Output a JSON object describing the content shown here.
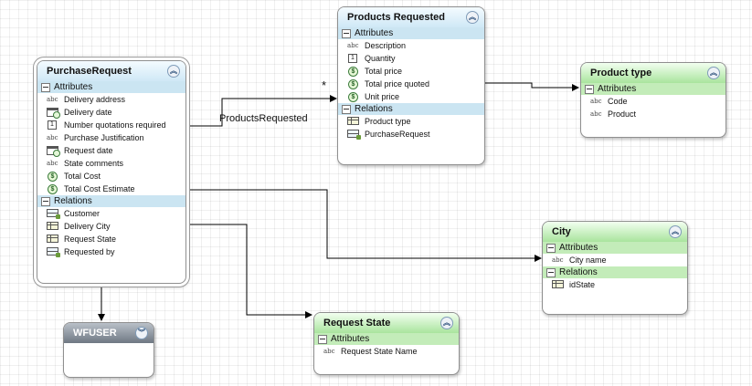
{
  "connector_labels": {
    "relation": "ProductsRequested",
    "multiplicity": "*"
  },
  "entities": {
    "purchase_request": {
      "title": "PurchaseRequest",
      "attributes_label": "Attributes",
      "attributes": [
        "Delivery address",
        "Delivery date",
        "Number quotations required",
        "Purchase Justification",
        "Request date",
        "State comments",
        "Total Cost",
        "Total Cost Estimate"
      ],
      "relations_label": "Relations",
      "relations": [
        "Customer",
        "Delivery City",
        "Request State",
        "Requested by"
      ]
    },
    "products_requested": {
      "title": "Products Requested",
      "attributes_label": "Attributes",
      "attributes": [
        "Description",
        "Quantity",
        "Total price",
        "Total price quoted",
        "Unit price"
      ],
      "relations_label": "Relations",
      "relations": [
        "Product type",
        "PurchaseRequest"
      ]
    },
    "product_type": {
      "title": "Product type",
      "attributes_label": "Attributes",
      "attributes": [
        "Code",
        "Product"
      ]
    },
    "city": {
      "title": "City",
      "attributes_label": "Attributes",
      "attributes": [
        "City name"
      ],
      "relations_label": "Relations",
      "relations": [
        "idState"
      ]
    },
    "request_state": {
      "title": "Request State",
      "attributes_label": "Attributes",
      "attributes": [
        "Request State Name"
      ]
    },
    "wfuser": {
      "title": "WFUSER"
    }
  },
  "icons": {
    "text": "abc-icon",
    "date": "calendar-icon",
    "number": "number-icon",
    "money": "currency-icon",
    "relation": "table-relation-icon",
    "collapse": "collapse-chevrons-icon",
    "section_toggle": "minus-box-icon"
  },
  "colors": {
    "blue_header": "#cfe8f6",
    "green_header": "#a9e49d",
    "gray_header": "#6f7883",
    "section_blue": "#cbe5f2",
    "section_green": "#c3ecb9"
  }
}
